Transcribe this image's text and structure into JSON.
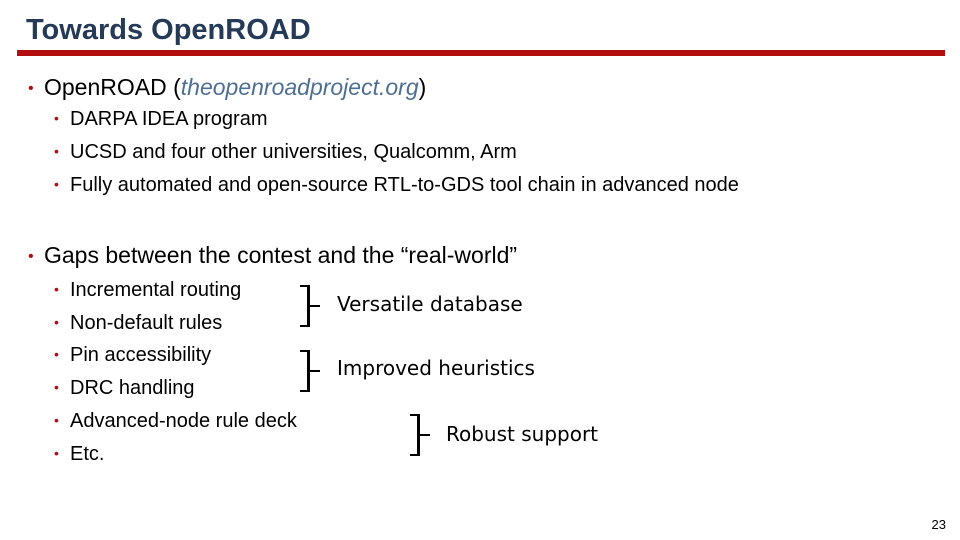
{
  "slide": {
    "title": "Towards OpenROAD",
    "page_number": "23",
    "colors": {
      "title": "#243a56",
      "accent": "#b20e10",
      "link": "#4e6f94"
    }
  },
  "section1": {
    "label_prefix": "OpenROAD (",
    "link_text": "theopenroadproject.org",
    "label_suffix": ")",
    "items": [
      "DARPA IDEA program",
      "UCSD and four other universities, Qualcomm, Arm",
      "Fully automated and open-source RTL-to-GDS tool chain in advanced node"
    ]
  },
  "section2": {
    "label": "Gaps between the contest and the “real-world”",
    "items": [
      "Incremental routing",
      "Non-default rules",
      "Pin accessibility",
      "DRC handling",
      "Advanced-node rule deck",
      "Etc."
    ],
    "groups": [
      {
        "label": "Versatile database"
      },
      {
        "label": "Improved heuristics"
      },
      {
        "label": "Robust support"
      }
    ]
  },
  "bullet_glyph": "•"
}
